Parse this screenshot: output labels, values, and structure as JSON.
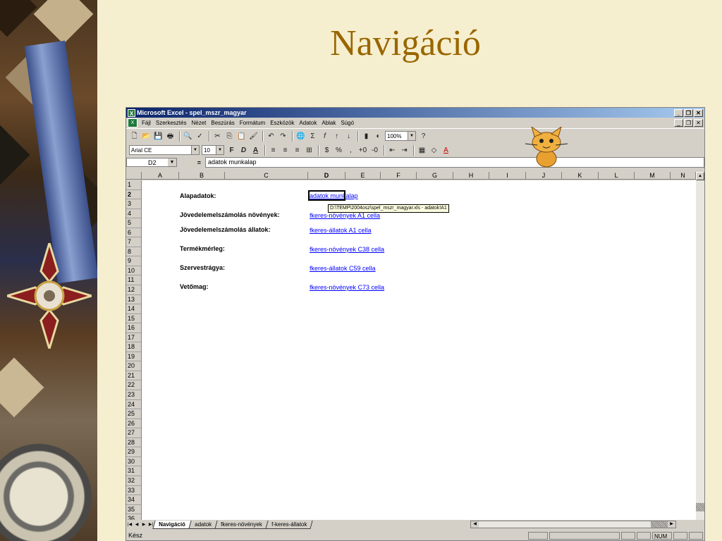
{
  "slide": {
    "title": "Navigáció"
  },
  "window": {
    "title": "Microsoft Excel - spel_mszr_magyar"
  },
  "menu": [
    "Fájl",
    "Szerkesztés",
    "Nézet",
    "Beszúrás",
    "Formátum",
    "Eszközök",
    "Adatok",
    "Ablak",
    "Súgó"
  ],
  "toolbar": {
    "zoom": "100%",
    "font": "Arial CE",
    "size": "10",
    "bold": "F",
    "italic": "D",
    "underline": "A"
  },
  "formula_bar": {
    "cell": "D2",
    "eq": "=",
    "value": "adatok munkalap"
  },
  "columns": [
    "A",
    "B",
    "C",
    "D",
    "E",
    "F",
    "G",
    "H",
    "I",
    "J",
    "K",
    "L",
    "M",
    "N"
  ],
  "rows": [
    "1",
    "2",
    "3",
    "4",
    "5",
    "6",
    "7",
    "8",
    "9",
    "10",
    "11",
    "12",
    "13",
    "14",
    "15",
    "16",
    "17",
    "18",
    "19",
    "20",
    "21",
    "22",
    "23",
    "24",
    "25",
    "26",
    "27",
    "28",
    "29",
    "30",
    "31",
    "32",
    "33",
    "34",
    "35",
    "36"
  ],
  "cells": [
    {
      "label": "Alapadatok:",
      "link": "adatok munkalap"
    },
    {
      "label": "Jövedelemelszámolás növények:",
      "link": "fkeres-növények A1 cella"
    },
    {
      "label": "Jövedelemelszámolás állatok:",
      "link": "fkeres-állatok A1 cella"
    },
    {
      "label": "Termékmérleg:",
      "link": "fkeres-növények C38 cella"
    },
    {
      "label": "Szervestrágya:",
      "link": "fkeres-állatok C59 cella"
    },
    {
      "label": "Vetőmag:",
      "link": "fkeres-növények C73 cella"
    }
  ],
  "tooltip": "D:\\TEMP\\2004osz\\spel_mszr_magyar.xls - adatok!A1",
  "sheets": [
    "Navigáció",
    "adatok",
    "fkeres-növények",
    "f-keres-állatok"
  ],
  "status": {
    "text": "Kész",
    "num": "NUM"
  },
  "colors": {
    "title": "#996600",
    "background": "#f6efcf",
    "link": "#0000ff"
  }
}
